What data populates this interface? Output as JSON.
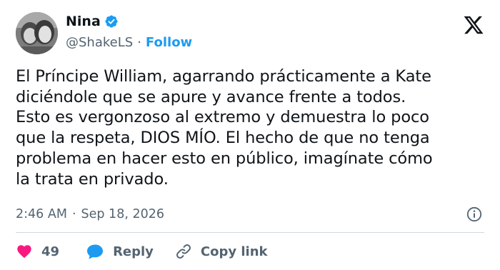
{
  "author": {
    "display_name": "Nina",
    "handle": "@ShakeLS",
    "separator": "·",
    "follow_label": "Follow"
  },
  "tweet": {
    "text": "El Príncipe William, agarrando prácticamente a Kate\ndiciéndole que se apure y avance frente a todos.\nEsto es vergonzoso al extremo y demuestra lo poco\nque la respeta, DIOS MÍO. El hecho de que no tenga\nproblema en hacer esto en público, imagínate cómo\nla trata en privado.",
    "time": "2:46 AM",
    "separator": "·",
    "date": "Sep 18, 2026"
  },
  "actions": {
    "like_count": "49",
    "reply_label": "Reply",
    "copy_link_label": "Copy link"
  },
  "icons": {
    "verified": "verified-badge-icon",
    "brand": "x-logo-icon",
    "info": "info-icon",
    "like": "heart-icon",
    "reply": "speech-bubble-icon",
    "copy": "link-icon"
  },
  "colors": {
    "accent": "#1d9bf0",
    "heart": "#f91880",
    "text": "#0f1419",
    "muted": "#536471",
    "divider": "#cfd9de"
  }
}
